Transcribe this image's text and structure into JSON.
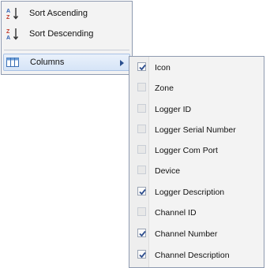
{
  "menu": {
    "items": [
      {
        "label": "Sort Ascending",
        "icon": "sort-ascending-icon"
      },
      {
        "label": "Sort Descending",
        "icon": "sort-descending-icon"
      },
      {
        "label": "Columns",
        "icon": "columns-icon",
        "has_submenu": true,
        "active": true
      }
    ]
  },
  "columns_submenu": {
    "items": [
      {
        "label": "Icon",
        "checked": true
      },
      {
        "label": "Zone",
        "checked": false
      },
      {
        "label": "Logger ID",
        "checked": false
      },
      {
        "label": "Logger Serial Number",
        "checked": false
      },
      {
        "label": "Logger Com Port",
        "checked": false
      },
      {
        "label": "Device",
        "checked": false
      },
      {
        "label": "Logger Description",
        "checked": true
      },
      {
        "label": "Channel ID",
        "checked": false
      },
      {
        "label": "Channel Number",
        "checked": true
      },
      {
        "label": "Channel Description",
        "checked": true
      }
    ]
  },
  "colors": {
    "menu_background": "#f3f3f3",
    "menu_border": "#8e9ab0",
    "active_item_background": "#d6e4f7",
    "check_color": "#2f4f8f"
  }
}
